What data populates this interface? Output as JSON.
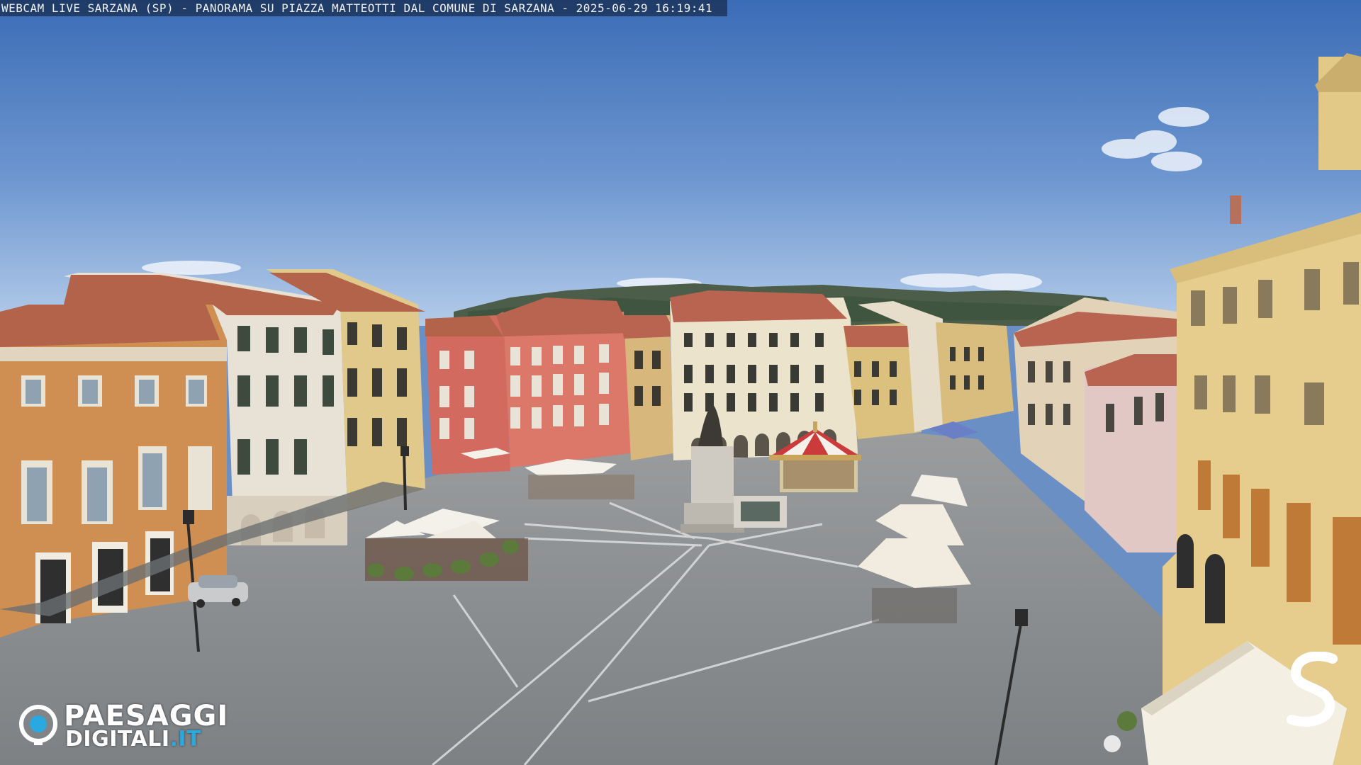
{
  "overlay": {
    "caption": "WEBCAM LIVE SARZANA (SP) - PANORAMA SU PIAZZA MATTEOTTI DAL COMUNE DI SARZANA - 2025-06-29  16:19:41"
  },
  "logo": {
    "line1": "PAESAGGI",
    "line2_main": "DIGITALI",
    "line2_tld": ".IT",
    "accent_color": "#2aa8e0"
  },
  "watermark": {
    "icon": "s-letter-logo"
  },
  "colors": {
    "sky_top": "#3f6fb8",
    "sky_bottom": "#a9c3e6",
    "pavement": "#8c8f92",
    "roof": "#b7644a"
  }
}
